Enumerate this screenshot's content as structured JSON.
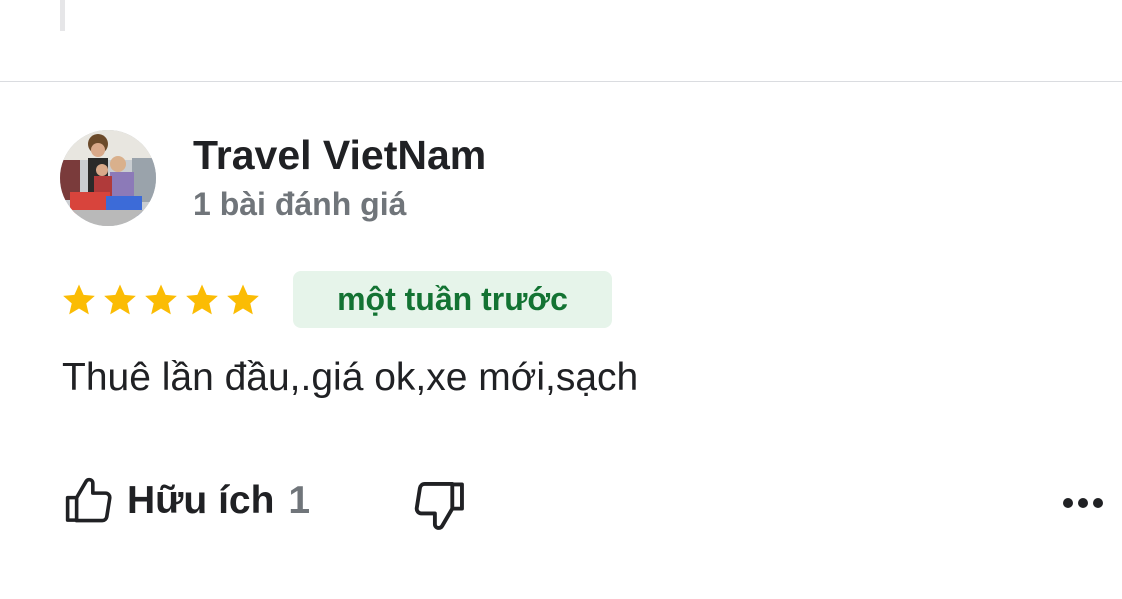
{
  "review": {
    "author_name": "Travel VietNam",
    "review_count": "1 bài đánh giá",
    "rating": 5,
    "max_rating": 5,
    "time": "một tuần trước",
    "text": "Thuê lần đầu,.giá ok,xe mới,sạch"
  },
  "actions": {
    "helpful_label": "Hữu ích",
    "helpful_count": "1"
  },
  "colors": {
    "star": "#fbbc04",
    "badge_bg": "#e6f4ea",
    "badge_text": "#137333",
    "secondary_text": "#70757a"
  },
  "icons": {
    "helpful": "thumbs-up-icon",
    "not_helpful": "thumbs-down-icon",
    "more": "more-horizontal-icon",
    "star": "star-icon"
  }
}
